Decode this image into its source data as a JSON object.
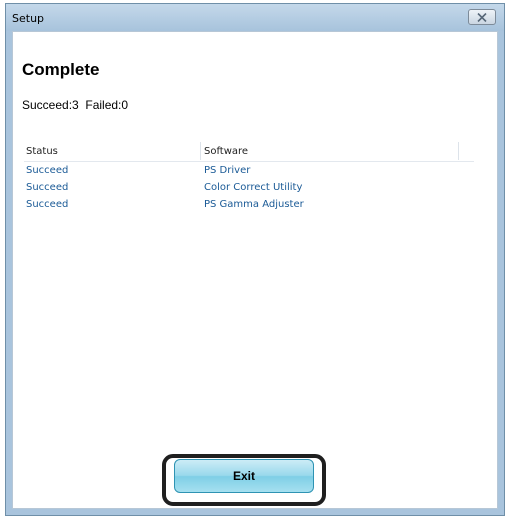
{
  "window": {
    "title": "Setup",
    "close_icon": "close-icon"
  },
  "content": {
    "heading": "Complete",
    "summary": "Succeed:3  Failed:0"
  },
  "table": {
    "headers": {
      "status": "Status",
      "software": "Software"
    },
    "rows": [
      {
        "status": "Succeed",
        "software": "PS Driver"
      },
      {
        "status": "Succeed",
        "software": "Color Correct Utility"
      },
      {
        "status": "Succeed",
        "software": "PS Gamma Adjuster"
      }
    ]
  },
  "footer": {
    "exit_label": "Exit"
  },
  "colors": {
    "link_text": "#1a5a96",
    "title_bar": "#a9c4dd",
    "exit_button": "#9ad9ec",
    "highlight_border": "#1f1f1f"
  }
}
